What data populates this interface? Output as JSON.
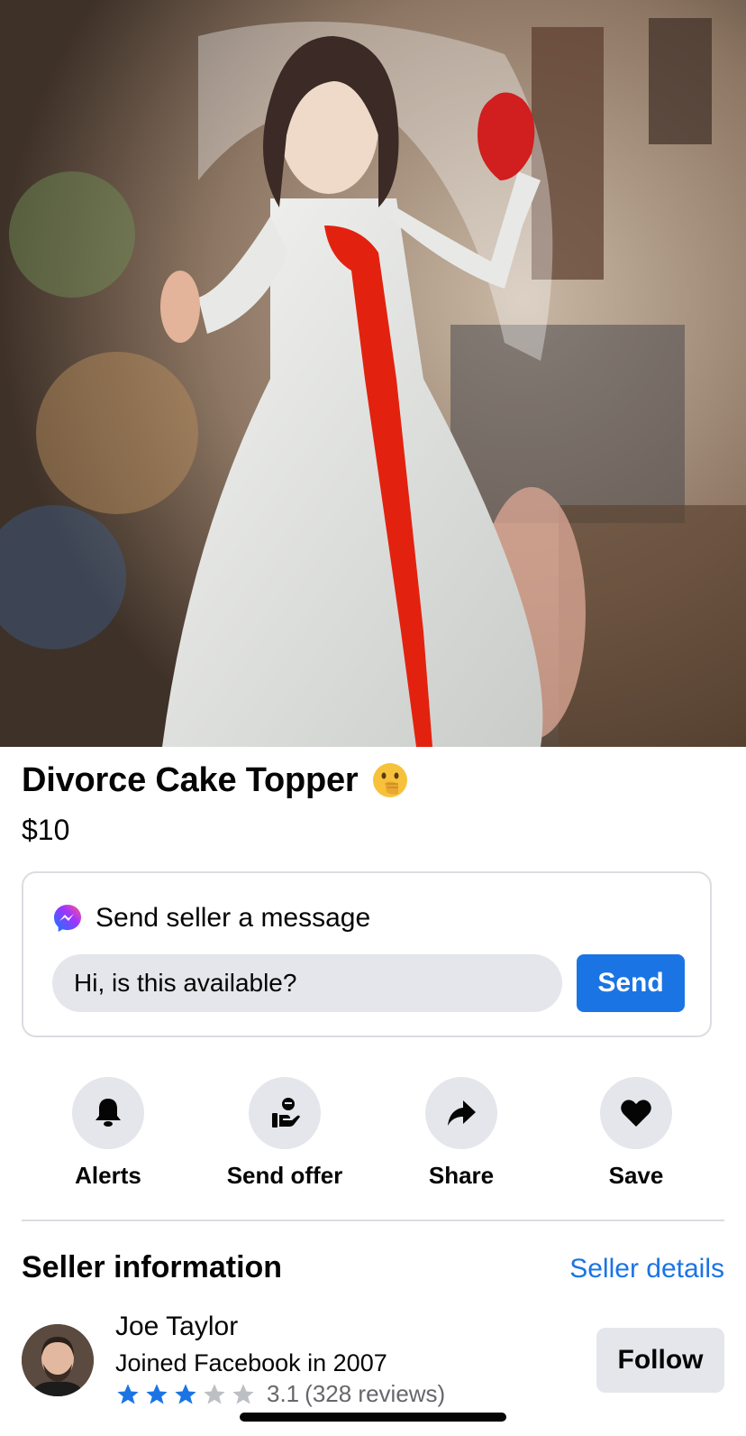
{
  "listing": {
    "title": "Divorce Cake Topper",
    "price": "$10"
  },
  "message_card": {
    "heading": "Send seller a message",
    "input_value": "Hi, is this available?",
    "send_label": "Send"
  },
  "actions": {
    "alerts": "Alerts",
    "send_offer": "Send offer",
    "share": "Share",
    "save": "Save"
  },
  "seller": {
    "section_heading": "Seller information",
    "details_link": "Seller details",
    "name": "Joe Taylor",
    "joined": "Joined Facebook in 2007",
    "rating": 3.1,
    "rating_label": "3.1",
    "reviews_label": "(328 reviews)",
    "follow_label": "Follow"
  },
  "icons": {
    "title_emoji": "face-with-hand-over-mouth-emoji",
    "messenger": "messenger-icon",
    "alerts": "bell-icon",
    "send_offer": "offer-hand-icon",
    "share": "share-arrow-icon",
    "save": "heart-icon",
    "star": "star-icon"
  },
  "colors": {
    "accent": "#1b74e4",
    "star_filled": "#1b74e4",
    "star_empty": "#bcc0c4",
    "button_bg": "#e4e6eb"
  }
}
